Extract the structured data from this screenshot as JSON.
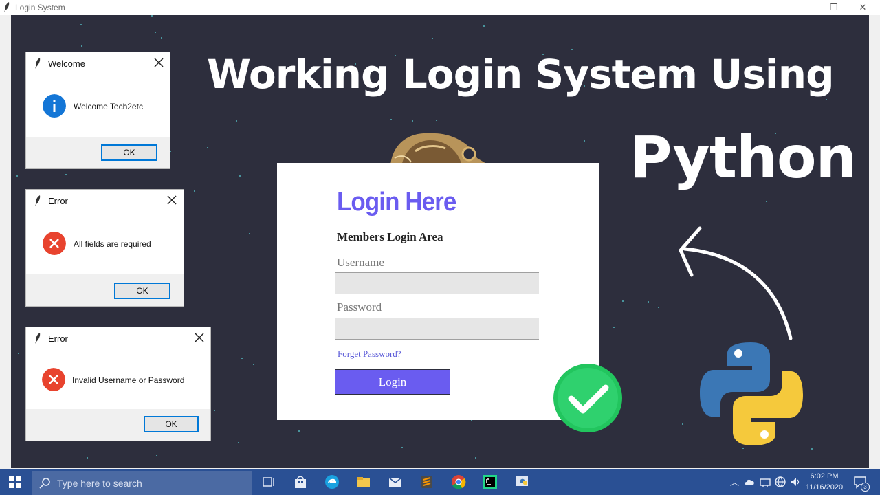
{
  "window": {
    "title": "Login System",
    "minimize": "—",
    "restore": "❐",
    "close": "✕"
  },
  "headline": {
    "line1": "Working Login System Using",
    "line2": "Python"
  },
  "dialogs": {
    "welcome": {
      "title": "Welcome",
      "message": "Welcome Tech2etc",
      "ok": "OK"
    },
    "error_required": {
      "title": "Error",
      "message": "All fields are required",
      "ok": "OK"
    },
    "error_invalid": {
      "title": "Error",
      "message": "Invalid Username or Password",
      "ok": "OK"
    }
  },
  "login": {
    "heading": "Login Here",
    "subheading": "Members Login Area",
    "username_label": "Username",
    "username_value": "",
    "password_label": "Password",
    "password_value": "",
    "forgot": "Forget Password?",
    "button": "Login"
  },
  "taskbar": {
    "search_placeholder": "Type here to search",
    "time": "6:02 PM",
    "date": "11/16/2020",
    "notification_count": "3"
  },
  "colors": {
    "background": "#2d2e3d",
    "accent": "#6a5cf0",
    "taskbar": "#2a5094",
    "error": "#e8432e",
    "info": "#1476d6",
    "success": "#22c55e"
  },
  "icons": [
    "feather-icon",
    "info-icon",
    "error-icon",
    "checkmark-icon",
    "arrow-icon",
    "python-logo",
    "windows-icon",
    "search-icon",
    "task-view-icon",
    "store-icon",
    "edge-icon",
    "file-explorer-icon",
    "mail-icon",
    "sublime-icon",
    "chrome-icon",
    "pycharm-icon",
    "python-taskbar-icon"
  ]
}
